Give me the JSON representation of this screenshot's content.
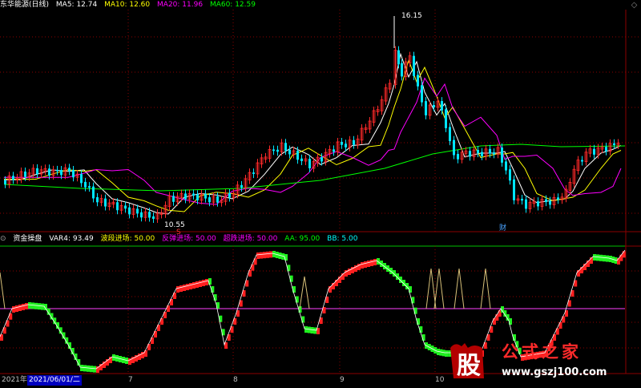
{
  "header": {
    "title": "东华能源(日线)",
    "ma": [
      {
        "label": "MA5: 12.74",
        "color": "#ffffff"
      },
      {
        "label": "MA10: 12.60",
        "color": "#ffff00"
      },
      {
        "label": "MA20: 11.96",
        "color": "#ff00ff"
      },
      {
        "label": "MA60: 12.59",
        "color": "#00ff00"
      }
    ]
  },
  "indicator_header": {
    "title": "资金操盘",
    "items": [
      {
        "label": "VAR4: 93.49",
        "color": "#ffffff"
      },
      {
        "label": "波段进场: 50.00",
        "color": "#ffff00"
      },
      {
        "label": "反弹进场: 50.00",
        "color": "#ff00ff"
      },
      {
        "label": "超跌进场: 50.00",
        "color": "#ff00ff"
      },
      {
        "label": "AA: 95.00",
        "color": "#00ff00"
      },
      {
        "label": "BB: 5.00",
        "color": "#00ffff"
      }
    ]
  },
  "annotations": {
    "high_label": "16.15",
    "low_label": "10.55",
    "marker_s": "S",
    "finance_label": "财"
  },
  "date_axis": {
    "year": "2021年",
    "cursor_date": "2021/06/01/二",
    "months": [
      "7",
      "8",
      "9",
      "10"
    ]
  },
  "watermark": {
    "big_char": "股",
    "text": "公式之家",
    "url": "www.gszj100.com"
  },
  "colors": {
    "up": "#ff2a2a",
    "down": "#00e5ff",
    "ind_up": "#ff2020",
    "ind_down": "#20f020",
    "grid": "#8b0000"
  },
  "chart_data": {
    "type": "candlestick",
    "price_high": 16.15,
    "price_low": 10.55,
    "ma_values": {
      "MA5": 12.74,
      "MA10": 12.6,
      "MA20": 11.96,
      "MA60": 12.59
    },
    "indicator_values": {
      "VAR4": 93.49,
      "AA": 95.0,
      "BB": 5.0,
      "波段进场": 50.0,
      "反弹进场": 50.0,
      "超跌进场": 50.0
    }
  }
}
